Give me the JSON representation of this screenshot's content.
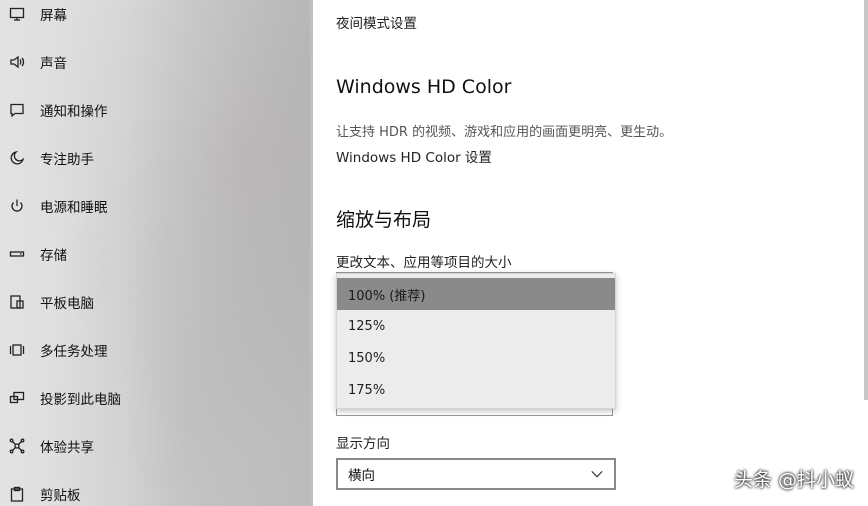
{
  "sidebar": {
    "items": [
      {
        "label": "屏幕",
        "icon": "monitor-icon"
      },
      {
        "label": "声音",
        "icon": "speaker-icon"
      },
      {
        "label": "通知和操作",
        "icon": "notification-icon"
      },
      {
        "label": "专注助手",
        "icon": "moon-icon"
      },
      {
        "label": "电源和睡眠",
        "icon": "power-icon"
      },
      {
        "label": "存储",
        "icon": "storage-icon"
      },
      {
        "label": "平板电脑",
        "icon": "tablet-icon"
      },
      {
        "label": "多任务处理",
        "icon": "multitask-icon"
      },
      {
        "label": "投影到此电脑",
        "icon": "project-icon"
      },
      {
        "label": "体验共享",
        "icon": "share-icon"
      },
      {
        "label": "剪贴板",
        "icon": "clipboard-icon"
      }
    ]
  },
  "main": {
    "night_light_link": "夜间模式设置",
    "hdr_heading": "Windows HD Color",
    "hdr_desc": "让支持 HDR 的视频、游戏和应用的画面更明亮、更生动。",
    "hdr_link": "Windows HD Color 设置",
    "scale_heading": "缩放与布局",
    "scale_label": "更改文本、应用等项目的大小",
    "scale_options": [
      {
        "label": "100% (推荐)",
        "selected": true
      },
      {
        "label": "125%",
        "selected": false
      },
      {
        "label": "150%",
        "selected": false
      },
      {
        "label": "175%",
        "selected": false
      }
    ],
    "orientation_label": "显示方向",
    "orientation_value": "横向"
  },
  "watermark": "头条 @抖小蚁"
}
